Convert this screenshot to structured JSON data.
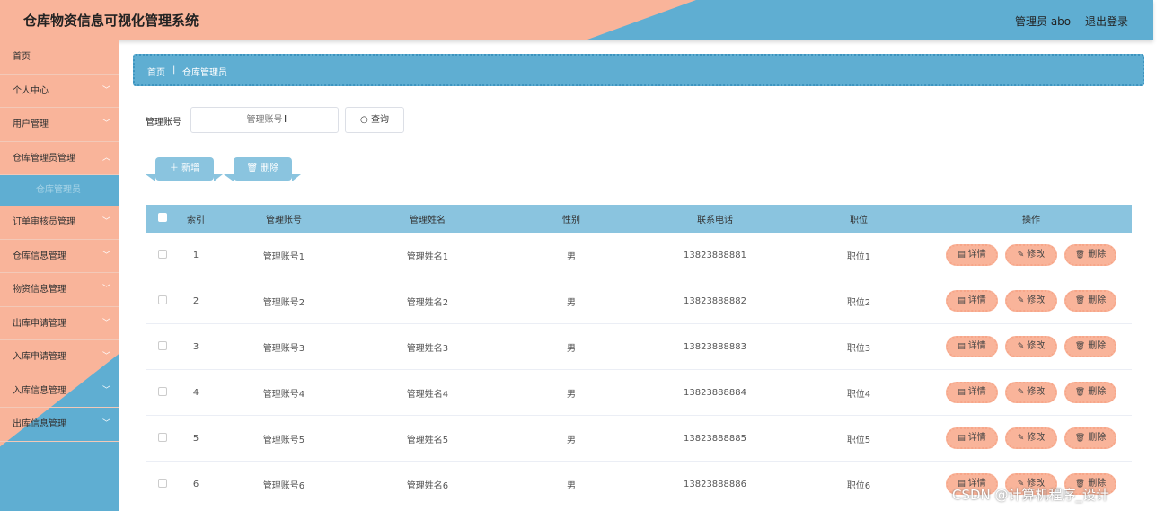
{
  "header": {
    "title": "仓库物资信息可视化管理系统",
    "user": "管理员 abo",
    "logout": "退出登录"
  },
  "sidebar": {
    "items": [
      {
        "label": "首页",
        "chevron": false
      },
      {
        "label": "个人中心",
        "chevron": true
      },
      {
        "label": "用户管理",
        "chevron": true
      },
      {
        "label": "仓库管理员管理",
        "chevron": true
      },
      {
        "label": "订单审核员管理",
        "chevron": true
      },
      {
        "label": "仓库信息管理",
        "chevron": true
      },
      {
        "label": "物资信息管理",
        "chevron": true
      },
      {
        "label": "出库申请管理",
        "chevron": true
      },
      {
        "label": "入库申请管理",
        "chevron": true
      },
      {
        "label": "入库信息管理",
        "chevron": true
      },
      {
        "label": "出库信息管理",
        "chevron": true
      }
    ],
    "active_sub": "仓库管理员"
  },
  "breadcrumb": {
    "home": "首页",
    "separator": "|",
    "current": "仓库管理员"
  },
  "search": {
    "label": "管理账号",
    "placeholder": "管理账号",
    "button": "查询"
  },
  "actions": {
    "add": "新增",
    "delete": "删除"
  },
  "table": {
    "headers": [
      "索引",
      "管理账号",
      "管理姓名",
      "性别",
      "联系电话",
      "职位",
      "操作"
    ],
    "rows": [
      {
        "index": "1",
        "account": "管理账号1",
        "name": "管理姓名1",
        "sex": "男",
        "phone": "13823888881",
        "position": "职位1"
      },
      {
        "index": "2",
        "account": "管理账号2",
        "name": "管理姓名2",
        "sex": "男",
        "phone": "13823888882",
        "position": "职位2"
      },
      {
        "index": "3",
        "account": "管理账号3",
        "name": "管理姓名3",
        "sex": "男",
        "phone": "13823888883",
        "position": "职位3"
      },
      {
        "index": "4",
        "account": "管理账号4",
        "name": "管理姓名4",
        "sex": "男",
        "phone": "13823888884",
        "position": "职位4"
      },
      {
        "index": "5",
        "account": "管理账号5",
        "name": "管理姓名5",
        "sex": "男",
        "phone": "13823888885",
        "position": "职位5"
      },
      {
        "index": "6",
        "account": "管理账号6",
        "name": "管理姓名6",
        "sex": "男",
        "phone": "13823888886",
        "position": "职位6"
      }
    ],
    "row_ops": {
      "detail": "详情",
      "edit": "修改",
      "delete": "删除"
    }
  },
  "watermark": "CSDN @计算机程序_设计",
  "colors": {
    "peach": "#f9b49a",
    "blue": "#5faed2",
    "light_blue": "#8ac4df"
  }
}
